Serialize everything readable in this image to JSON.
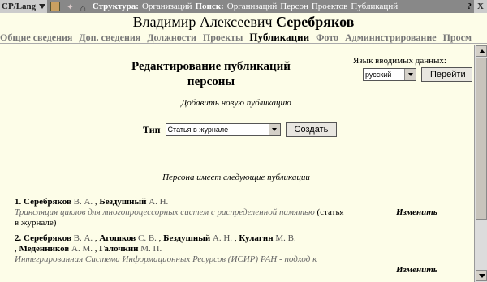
{
  "topbar": {
    "lang_label": "CP/Lang",
    "structure_label": "Структура:",
    "structure_link": "Организаций",
    "search_label": "Поиск:",
    "search_links": [
      "Организаций",
      "Персон",
      "Проектов",
      "Публикаций"
    ],
    "help": "?",
    "close": "X"
  },
  "person": {
    "first_names": "Владимир Алексеевич",
    "last_name": "Серебряков"
  },
  "tabs": [
    {
      "label": "Общие сведения",
      "active": false
    },
    {
      "label": "Доп. сведения",
      "active": false
    },
    {
      "label": "Должности",
      "active": false
    },
    {
      "label": "Проекты",
      "active": false
    },
    {
      "label": "Публикации",
      "active": true
    },
    {
      "label": "Фото",
      "active": false
    },
    {
      "label": "Администрирование",
      "active": false
    },
    {
      "label": "Просм",
      "active": false
    }
  ],
  "heading": {
    "line1": "Редактирование публикаций",
    "line2": "персоны"
  },
  "language": {
    "label": "Язык вводимых данных:",
    "selected": "русский",
    "go_button": "Перейти"
  },
  "add_new": "Добавить новую публикацию",
  "type_select": {
    "label": "Тип",
    "selected": "Статья в журнале",
    "create_button": "Создать"
  },
  "list_caption": "Персона имеет следующие публикации",
  "publications": [
    {
      "number": "1.",
      "authors_line1": [
        {
          "surname": "Серебряков",
          "initials": "В.  А."
        },
        {
          "surname": "Бездушный",
          "initials": "А.  Н."
        }
      ],
      "authors_line2": [],
      "title": "Трансляция циклов для многопроцессорных систем с распределенной памятью",
      "suffix": " (статья",
      "suffix2": "в журнале)",
      "edit": "Изменить"
    },
    {
      "number": "2.",
      "authors_line1": [
        {
          "surname": "Серебряков",
          "initials": "В.  А."
        },
        {
          "surname": "Агошков",
          "initials": "С.  В."
        },
        {
          "surname": "Бездушный",
          "initials": "А.  Н."
        },
        {
          "surname": "Кулагин",
          "initials": "М.  В."
        }
      ],
      "authors_line2": [
        {
          "surname": "Меденников",
          "initials": "А.  М."
        },
        {
          "surname": "Галочкин",
          "initials": "М.  П."
        }
      ],
      "title": "Интегрированная Система Информационных Ресурсов (ИСИР) РАН - подход к",
      "suffix": "",
      "suffix2": "",
      "edit": "Изменить"
    }
  ]
}
